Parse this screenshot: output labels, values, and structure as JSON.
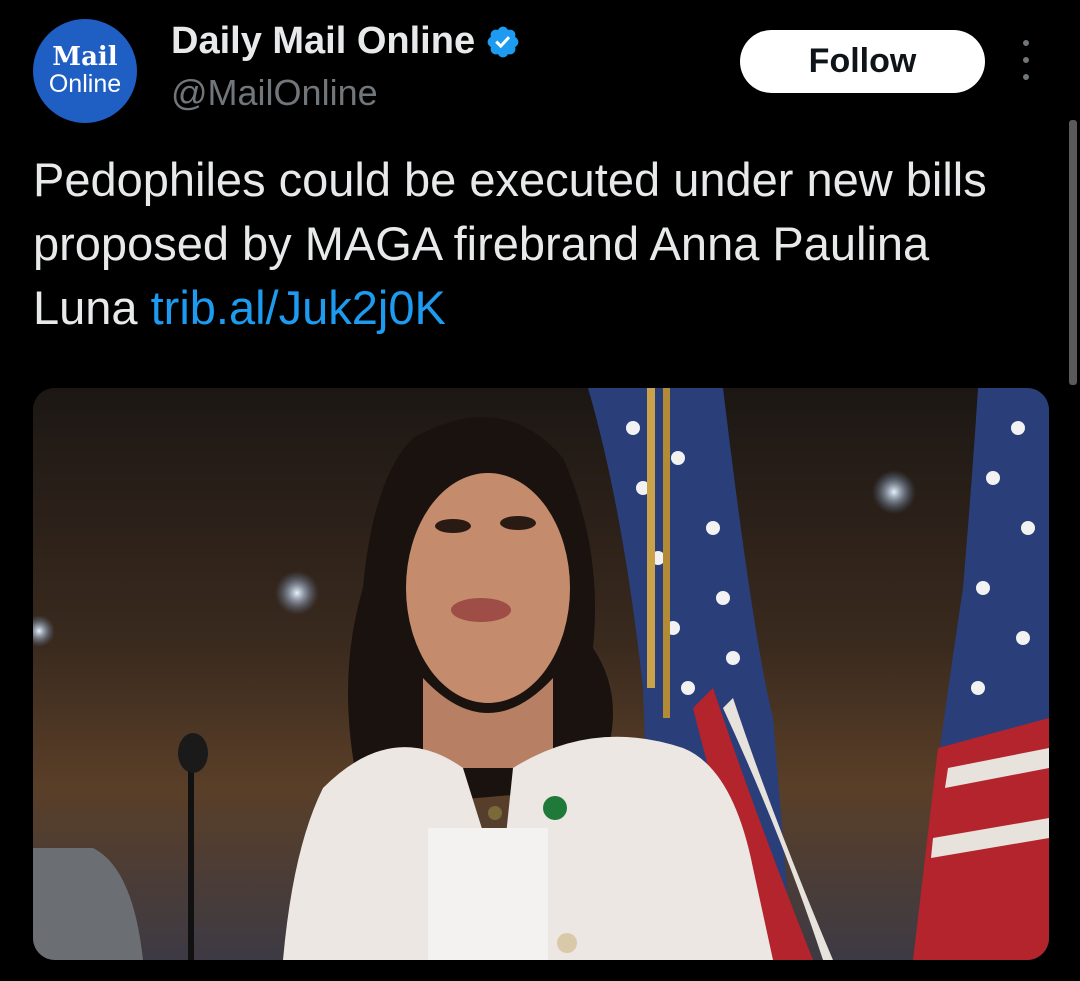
{
  "author": {
    "avatar_line1": "Mail",
    "avatar_line2": "Online",
    "name": "Daily Mail Online",
    "handle": "@MailOnline",
    "verified_icon": "verified-badge-icon"
  },
  "actions": {
    "follow_label": "Follow",
    "more_icon": "more-vertical-icon"
  },
  "tweet": {
    "text": "Pedophiles could be executed under new bills proposed by MAGA firebrand Anna Paulina Luna ",
    "link": "trib.al/Juk2j0K"
  },
  "colors": {
    "background": "#000000",
    "link": "#1d9bf0",
    "verified": "#1d9bf0",
    "avatar": "#1f5fc4"
  }
}
